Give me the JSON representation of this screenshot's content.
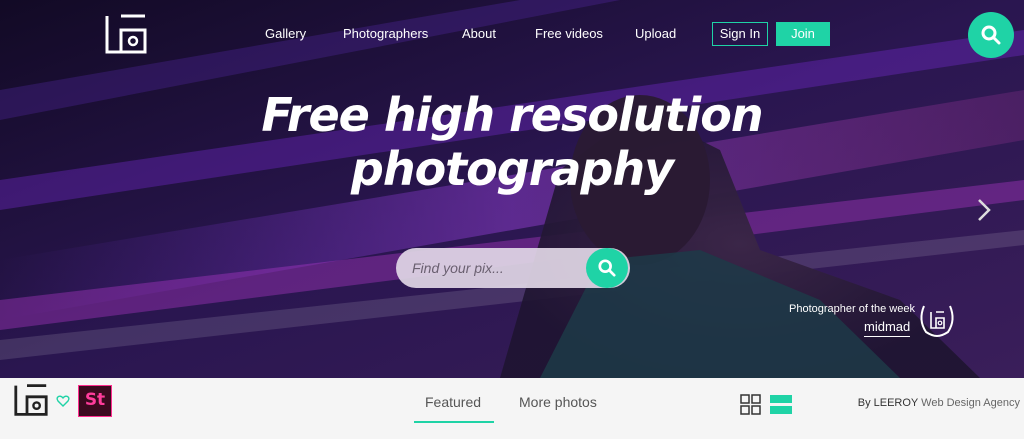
{
  "nav": {
    "links": [
      "Gallery",
      "Photographers",
      "About",
      "Free videos",
      "Upload"
    ],
    "signin_label": "Sign In",
    "join_label": "Join"
  },
  "hero": {
    "headline_line1": "Free high resolution",
    "headline_line2": "photography"
  },
  "search": {
    "placeholder": "Find your pix..."
  },
  "photographer_of_week": {
    "label": "Photographer of the week",
    "name": "midmad"
  },
  "bottom_bar": {
    "tabs": [
      "Featured",
      "More photos"
    ],
    "st_badge": "St",
    "credit_by": "By LEEROY",
    "credit_agency": "Web Design Agency"
  },
  "colors": {
    "accent": "#1fd3a6",
    "hero_bg": "#1a0f2e",
    "magenta": "#ff2d8f"
  },
  "icons": [
    "logo-icon",
    "search-icon",
    "chevron-right-icon",
    "laurel-badge-icon",
    "heart-icon",
    "grid-view-icon",
    "list-view-icon"
  ]
}
